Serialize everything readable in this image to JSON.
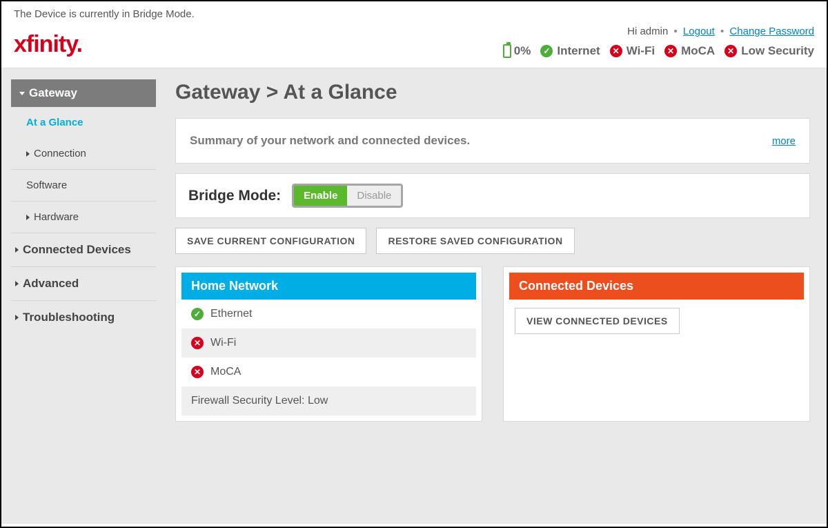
{
  "notice": "The Device is currently in Bridge Mode.",
  "logo_text": "xfinity.",
  "auth": {
    "greeting": "Hi admin",
    "logout": "Logout",
    "change_password": "Change Password"
  },
  "status_bar": {
    "battery": "0%",
    "items": [
      {
        "label": "Internet",
        "ok": true
      },
      {
        "label": "Wi-Fi",
        "ok": false
      },
      {
        "label": "MoCA",
        "ok": false
      },
      {
        "label": "Low Security",
        "ok": false
      }
    ]
  },
  "sidebar": {
    "header": "Gateway",
    "items": [
      {
        "label": "At a Glance",
        "active": true,
        "indent": true,
        "caret": false
      },
      {
        "label": "Connection",
        "active": false,
        "indent": true,
        "caret": true
      },
      {
        "label": "Software",
        "active": false,
        "indent": true,
        "caret": false
      },
      {
        "label": "Hardware",
        "active": false,
        "indent": true,
        "caret": true
      },
      {
        "label": "Connected Devices",
        "active": false,
        "indent": false,
        "caret": true
      },
      {
        "label": "Advanced",
        "active": false,
        "indent": false,
        "caret": true
      },
      {
        "label": "Troubleshooting",
        "active": false,
        "indent": false,
        "caret": true
      }
    ]
  },
  "page": {
    "title": "Gateway > At a Glance",
    "summary": "Summary of your network and connected devices.",
    "more": "more",
    "bridge": {
      "label": "Bridge Mode:",
      "enable": "Enable",
      "disable": "Disable"
    },
    "save_btn": "SAVE CURRENT CONFIGURATION",
    "restore_btn": "RESTORE SAVED CONFIGURATION",
    "home_network": {
      "title": "Home Network",
      "rows": [
        {
          "label": "Ethernet",
          "ok": true
        },
        {
          "label": "Wi-Fi",
          "ok": false
        },
        {
          "label": "MoCA",
          "ok": false
        }
      ],
      "firewall_label": "Firewall Security Level:",
      "firewall_value": "Low"
    },
    "connected": {
      "title": "Connected Devices",
      "view_btn": "VIEW CONNECTED DEVICES"
    }
  }
}
